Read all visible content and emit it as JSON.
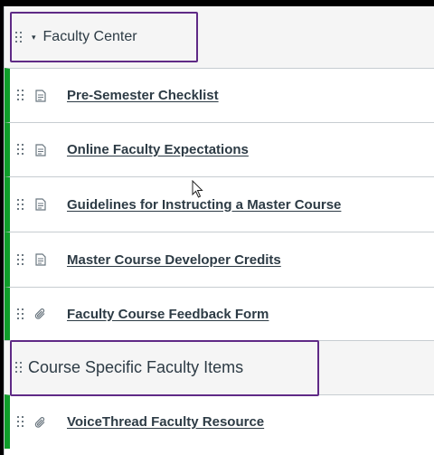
{
  "modules": {
    "faculty_center": {
      "title": "Faculty Center",
      "caret": "▾",
      "items": [
        {
          "label": "Pre-Semester Checklist",
          "icon": "page-icon"
        },
        {
          "label": "Online Faculty Expectations",
          "icon": "page-icon"
        },
        {
          "label": "Guidelines for Instructing a Master Course",
          "icon": "page-icon"
        },
        {
          "label": "Master Course Developer Credits",
          "icon": "page-icon"
        },
        {
          "label": "Faculty Course Feedback Form",
          "icon": "attachment-icon"
        }
      ]
    },
    "course_specific": {
      "title": "Course Specific Faculty Items",
      "items": [
        {
          "label": "VoiceThread Faculty Resource",
          "icon": "attachment-icon"
        }
      ]
    }
  },
  "colors": {
    "highlight_border": "#5f2a86",
    "published_bar": "#0f9d2a",
    "text": "#2d3b45"
  }
}
